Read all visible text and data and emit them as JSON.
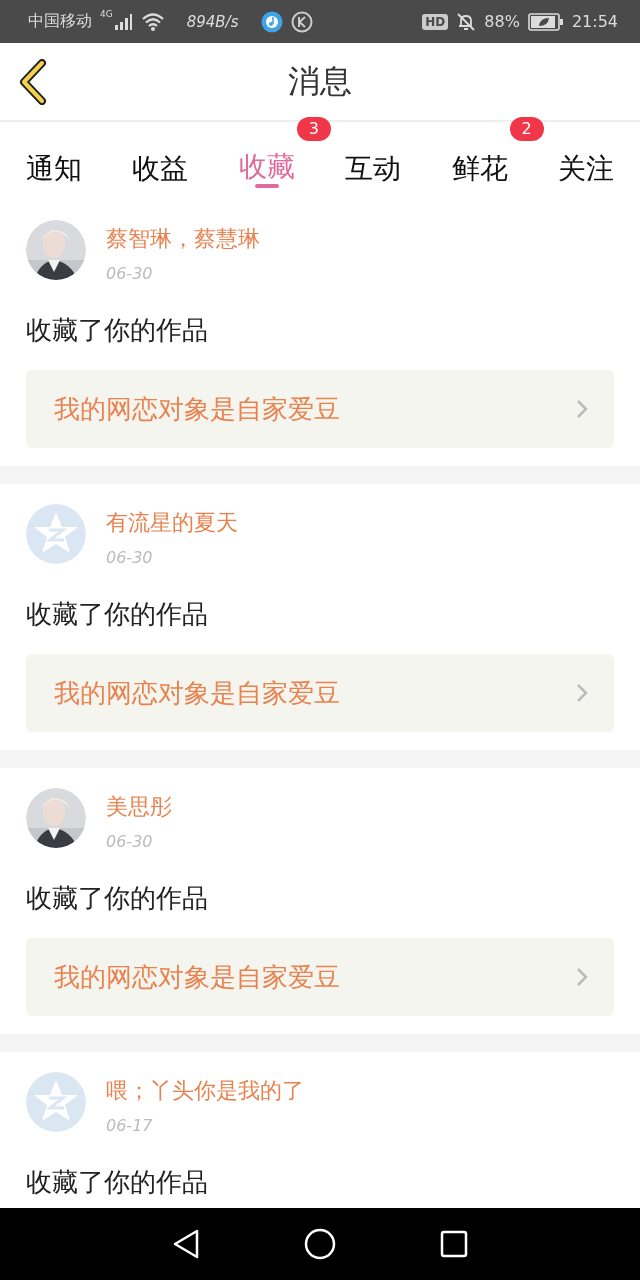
{
  "status_bar": {
    "carrier": "中国移动",
    "network": "4G",
    "speed": "894B/s",
    "hd": "HD",
    "battery": "88%",
    "time": "21:54"
  },
  "header": {
    "title": "消息"
  },
  "tabs": [
    {
      "label": "通知",
      "selected": false
    },
    {
      "label": "收益",
      "selected": false
    },
    {
      "label": "收藏",
      "selected": true,
      "badge": "3"
    },
    {
      "label": "互动",
      "selected": false
    },
    {
      "label": "鲜花",
      "selected": false,
      "badge": "2"
    },
    {
      "label": "关注",
      "selected": false
    }
  ],
  "messages": [
    {
      "name": "蔡智琳，蔡慧琳",
      "date": "06-30",
      "text": "收藏了你的作品",
      "work": "我的网恋对象是自家爱豆"
    },
    {
      "avatar": {
        "kind": "default"
      },
      "name": "有流星的夏天",
      "date": "06-30",
      "text": "收藏了你的作品",
      "work": "我的网恋对象是自家爱豆"
    },
    {
      "name": "美思彤",
      "date": "06-30",
      "text": "收藏了你的作品",
      "work": "我的网恋对象是自家爱豆"
    },
    {
      "avatar": {
        "kind": "default"
      },
      "name": "喂；丫头你是我的了",
      "date": "06-17",
      "text": "收藏了你的作品"
    }
  ]
}
